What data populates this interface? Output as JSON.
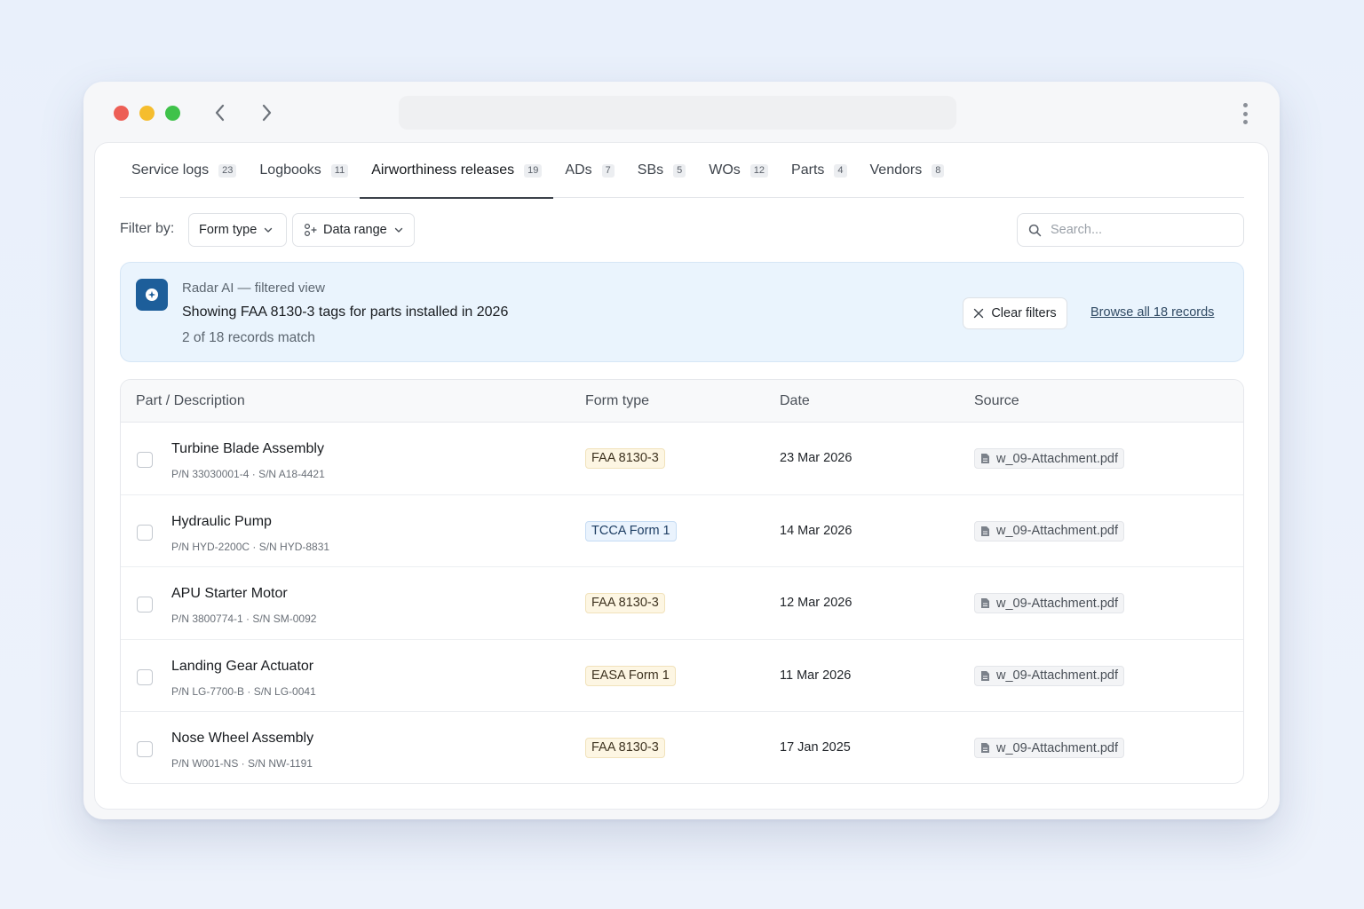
{
  "tabs": [
    {
      "label": "Service logs",
      "count": "23"
    },
    {
      "label": "Logbooks",
      "count": "11"
    },
    {
      "label": "Airworthiness releases",
      "count": "19",
      "active": true
    },
    {
      "label": "ADs",
      "count": "7"
    },
    {
      "label": "SBs",
      "count": "5"
    },
    {
      "label": "WOs",
      "count": "12"
    },
    {
      "label": "Parts",
      "count": "4"
    },
    {
      "label": "Vendors",
      "count": "8"
    }
  ],
  "filters": {
    "label": "Filter by:",
    "form_type": "Form type",
    "data_range": "Data range",
    "search_placeholder": "Search..."
  },
  "ai": {
    "kicker": "Radar AI — filtered view",
    "title": "Showing FAA 8130-3 tags for parts installed in 2026",
    "count": "2 of 18 records match",
    "clear_label": "Clear filters",
    "browse_label": "Browse all 18 records"
  },
  "table": {
    "columns": [
      "Part / Description",
      "Form type",
      "Date",
      "Source"
    ],
    "rows": [
      {
        "name": "Turbine Blade Assembly",
        "meta": "P/N 33030001-4 · S/N A18-4421",
        "form": "FAA 8130-3",
        "form_style": "amber",
        "date": "23 Mar 2026",
        "source": "w_09-Attachment.pdf"
      },
      {
        "name": "Hydraulic Pump",
        "meta": "P/N HYD-2200C · S/N HYD-8831",
        "form": "TCCA Form 1",
        "form_style": "blue",
        "date": "14 Mar 2026",
        "source": "w_09-Attachment.pdf"
      },
      {
        "name": "APU Starter Motor",
        "meta": "P/N 3800774-1 · S/N SM-0092",
        "form": "FAA 8130-3",
        "form_style": "amber",
        "date": "12 Mar 2026",
        "source": "w_09-Attachment.pdf"
      },
      {
        "name": "Landing Gear Actuator",
        "meta": "P/N LG-7700-B · S/N LG-0041",
        "form": "EASA Form 1",
        "form_style": "amber",
        "date": "11 Mar 2026",
        "source": "w_09-Attachment.pdf"
      },
      {
        "name": "Nose Wheel Assembly",
        "meta": "P/N W001-NS · S/N NW-1191",
        "form": "FAA 8130-3",
        "form_style": "amber",
        "date": "17 Jan 2025",
        "source": "w_09-Attachment.pdf"
      }
    ]
  },
  "icons": {
    "back": "chevron-left-icon",
    "forward": "chevron-right-icon",
    "menu": "kebab-icon",
    "ai": "sparkle-icon",
    "search": "search-icon",
    "clear": "close-icon",
    "file": "file-icon"
  },
  "colors": {
    "accent": "#1d5e9a",
    "ai_bg": "#eaf4fd",
    "badge_amber": "#fdf6e3",
    "badge_blue": "#eaf3fd"
  }
}
